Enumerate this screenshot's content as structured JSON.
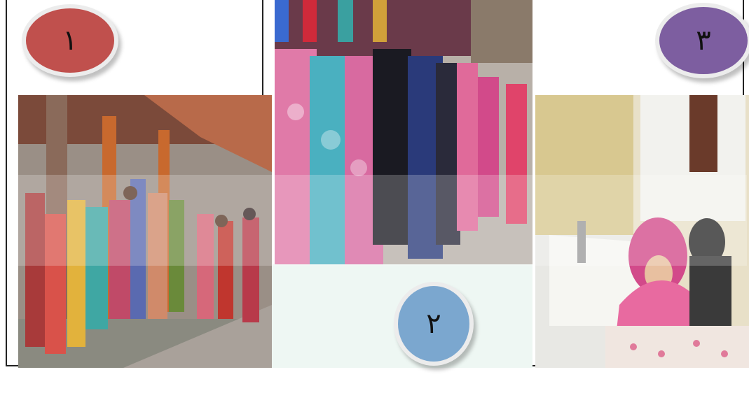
{
  "panels": [
    {
      "id": "panel-1",
      "badge_label": "١",
      "badge_color": "#c0504d"
    },
    {
      "id": "panel-2",
      "badge_label": "٢",
      "badge_color": "#7ba7cf"
    },
    {
      "id": "panel-3",
      "badge_label": "٣",
      "badge_color": "#7d5ea0"
    }
  ],
  "colors": {
    "mint_background": "#eef7f3",
    "frame_line": "#222222"
  }
}
